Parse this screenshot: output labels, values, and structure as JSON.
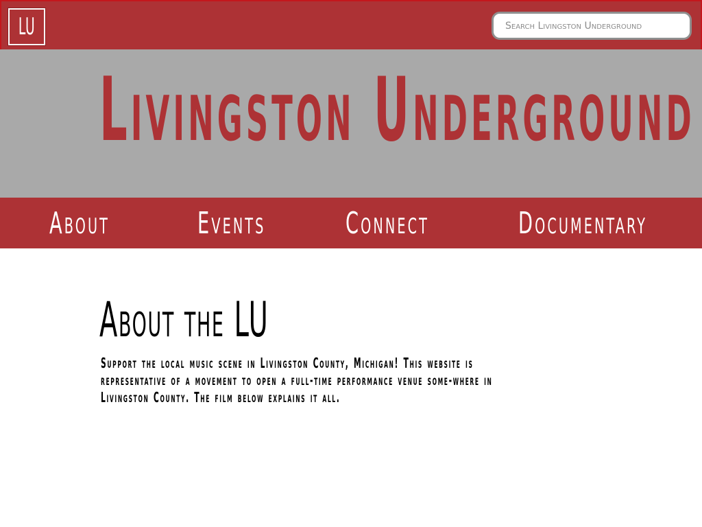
{
  "header": {
    "logo_text": "LU",
    "search_placeholder": "Search Livingston Underground"
  },
  "banner": {
    "title": "Livingston Underground"
  },
  "nav": {
    "items": [
      {
        "label": "About"
      },
      {
        "label": "Events"
      },
      {
        "label": "Connect"
      },
      {
        "label": "Documentary"
      }
    ]
  },
  "main": {
    "heading": "About the LU",
    "body": "Support the local music scene in Livingston County, Michigan! This website is representative of a movement to open a full-time performance venue some-where in Livingston County. The film below explains it all."
  },
  "colors": {
    "brand_red": "#ad3235",
    "banner_gray": "#a9a9a9"
  }
}
